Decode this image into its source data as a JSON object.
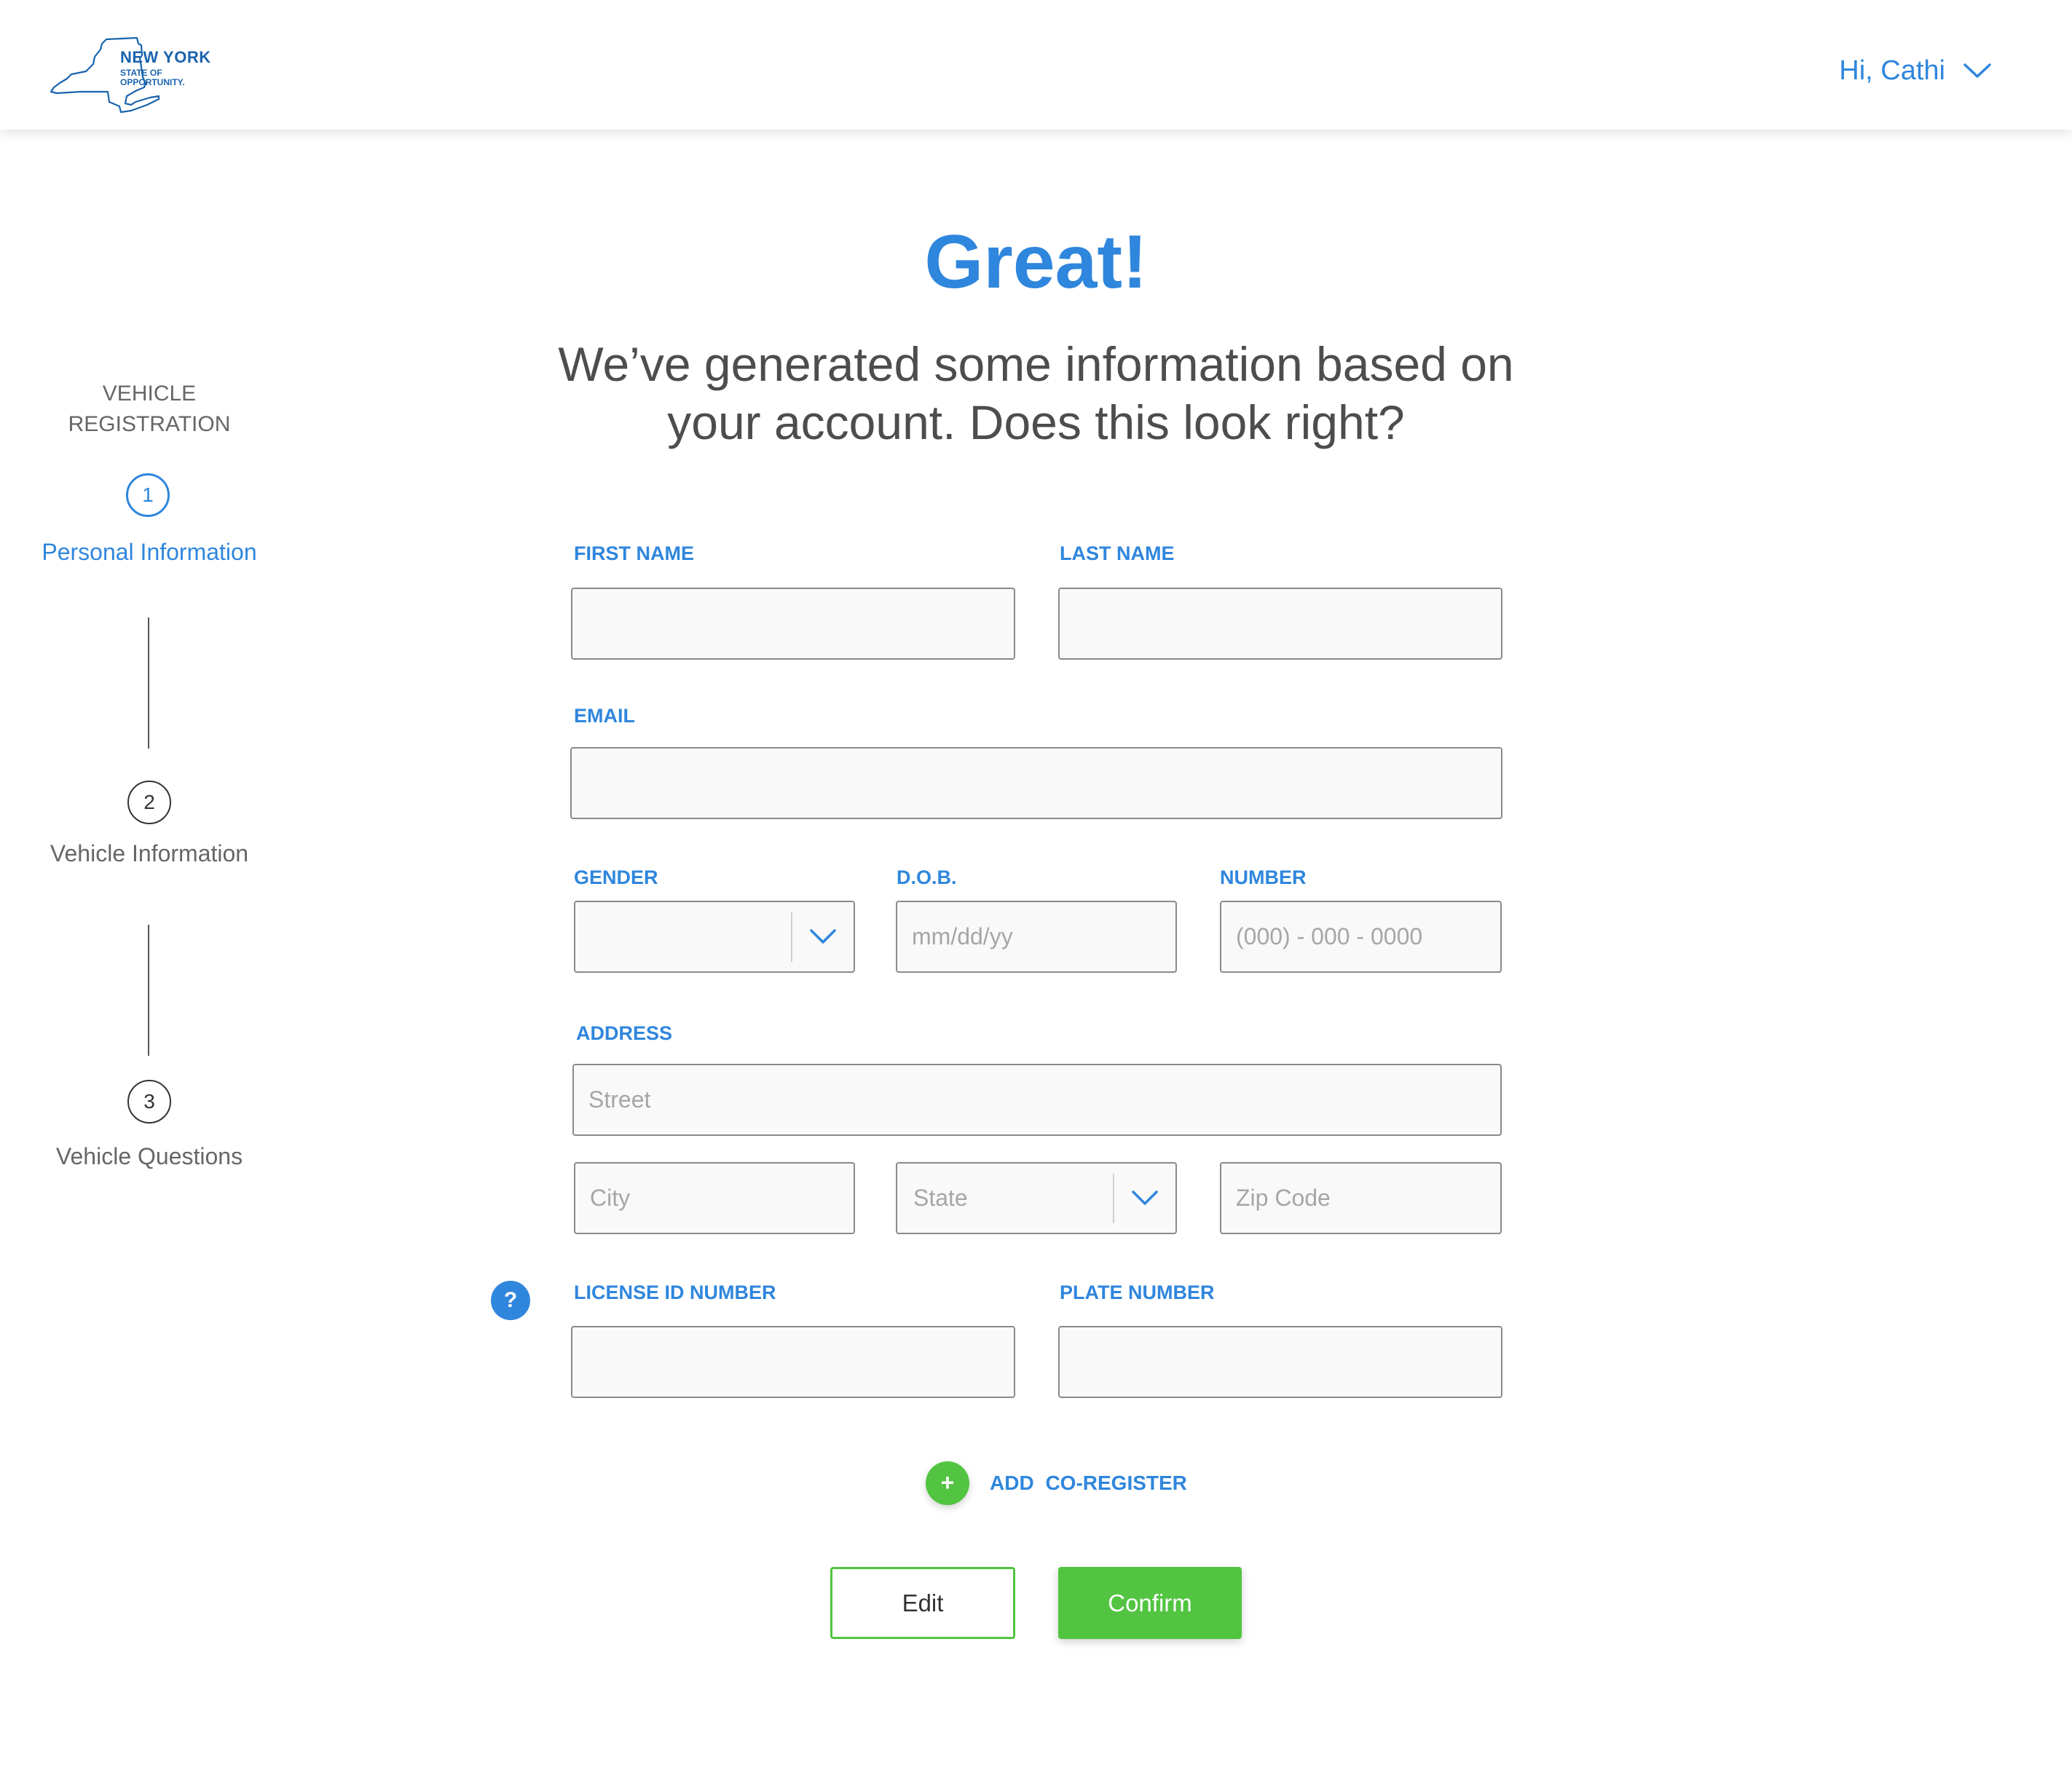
{
  "colors": {
    "accent": "#2f86dd",
    "success": "#52c441",
    "text": "#555555",
    "input_border": "#8a8a8a"
  },
  "header": {
    "logo": {
      "line1": "NEW YORK",
      "line2": "STATE OF",
      "line3": "OPPORTUNITY."
    },
    "user_greeting": "Hi, Cathi",
    "user_menu_icon": "chevron-down-icon"
  },
  "sidebar": {
    "title": "VEHICLE REGISTRATION",
    "steps": [
      {
        "number": "1",
        "label": "Personal Information",
        "active": true
      },
      {
        "number": "2",
        "label": "Vehicle Information",
        "active": false
      },
      {
        "number": "3",
        "label": "Vehicle Questions",
        "active": false
      }
    ]
  },
  "main": {
    "title": "Great!",
    "subtitle": "We’ve generated some information based on your account. Does this look right?"
  },
  "form": {
    "first_name": {
      "label": "FIRST NAME",
      "value": "",
      "placeholder": ""
    },
    "last_name": {
      "label": "LAST NAME",
      "value": "",
      "placeholder": ""
    },
    "email": {
      "label": "EMAIL",
      "value": "",
      "placeholder": ""
    },
    "gender": {
      "label": "GENDER",
      "value": ""
    },
    "dob": {
      "label": "D.O.B.",
      "placeholder": "mm/dd/yy"
    },
    "number": {
      "label": "NUMBER",
      "placeholder": "(000) - 000 - 0000"
    },
    "address": {
      "label": "ADDRESS",
      "street_placeholder": "Street",
      "city_placeholder": "City",
      "state_value": "State",
      "zip_placeholder": "Zip Code"
    },
    "license_id": {
      "label": "LICENSE ID NUMBER",
      "value": ""
    },
    "plate_number": {
      "label": "PLATE NUMBER",
      "value": ""
    },
    "help_icon_glyph": "?",
    "add_coregister": {
      "glyph": "+",
      "label": "ADD  CO-REGISTER"
    }
  },
  "actions": {
    "edit_label": "Edit",
    "confirm_label": "Confirm"
  }
}
